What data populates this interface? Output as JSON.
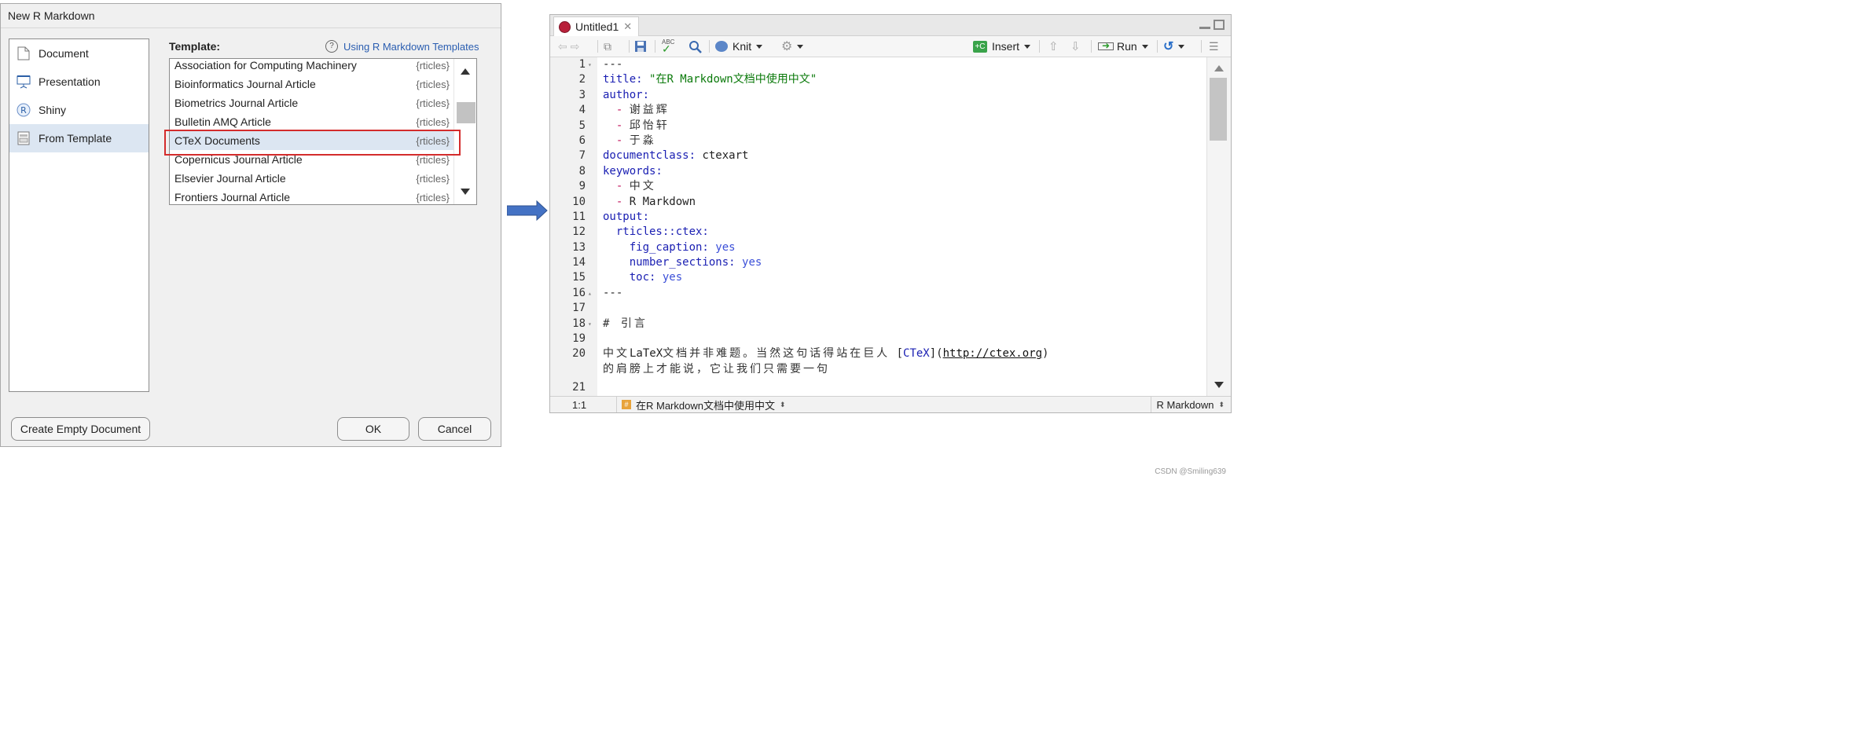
{
  "dialog": {
    "title": "New R Markdown",
    "doc_types": [
      {
        "label": "Document",
        "icon": "document-icon"
      },
      {
        "label": "Presentation",
        "icon": "presentation-icon"
      },
      {
        "label": "Shiny",
        "icon": "shiny-icon"
      },
      {
        "label": "From Template",
        "icon": "template-icon",
        "selected": true
      }
    ],
    "template_label": "Template:",
    "help_link": "Using R Markdown Templates",
    "templates": [
      {
        "name": "Association for Computing Machinery",
        "pkg": "{rticles}"
      },
      {
        "name": "Bioinformatics Journal Article",
        "pkg": "{rticles}"
      },
      {
        "name": "Biometrics Journal Article",
        "pkg": "{rticles}"
      },
      {
        "name": "Bulletin AMQ Article",
        "pkg": "{rticles}"
      },
      {
        "name": "CTeX Documents",
        "pkg": "{rticles}",
        "selected": true
      },
      {
        "name": "Copernicus Journal Article",
        "pkg": "{rticles}"
      },
      {
        "name": "Elsevier Journal Article",
        "pkg": "{rticles}"
      },
      {
        "name": "Frontiers Journal Article",
        "pkg": "{rticles}"
      }
    ],
    "buttons": {
      "empty": "Create Empty Document",
      "ok": "OK",
      "cancel": "Cancel"
    }
  },
  "editor": {
    "tab_title": "Untitled1",
    "toolbar": {
      "knit": "Knit",
      "insert": "Insert",
      "run": "Run"
    },
    "lines": [
      {
        "n": "1",
        "fold": "▾"
      },
      {
        "n": "2"
      },
      {
        "n": "3"
      },
      {
        "n": "4"
      },
      {
        "n": "5"
      },
      {
        "n": "6"
      },
      {
        "n": "7"
      },
      {
        "n": "8"
      },
      {
        "n": "9"
      },
      {
        "n": "10"
      },
      {
        "n": "11"
      },
      {
        "n": "12"
      },
      {
        "n": "13"
      },
      {
        "n": "14"
      },
      {
        "n": "15"
      },
      {
        "n": "16",
        "fold": "▴"
      },
      {
        "n": "17"
      },
      {
        "n": "18",
        "fold": "▾"
      },
      {
        "n": "19"
      },
      {
        "n": "20"
      },
      {
        "n": ""
      },
      {
        "n": "21"
      }
    ],
    "code": {
      "l1": "---",
      "l2_key": "title: ",
      "l2_val": "\"在R Markdown文档中使用中文\"",
      "l3": "author:",
      "l4": "谢益辉",
      "l5": "邱怡轩",
      "l6": "于淼",
      "l7_key": "documentclass: ",
      "l7_val": "ctexart",
      "l8": "keywords:",
      "l9": "中文",
      "l10": "R Markdown",
      "l11": "output:",
      "l12": "rticles::ctex:",
      "l13_key": "fig_caption: ",
      "l13_val": "yes",
      "l14_key": "number_sections: ",
      "l14_val": "yes",
      "l15_key": "toc: ",
      "l15_val": "yes",
      "l16": "---",
      "l18": "# 引言",
      "l20_a": "中文",
      "l20_b": "LaTeX",
      "l20_c": "文档并非难题。当然这句话得站在巨人",
      "l20_link_open": " [",
      "l20_link": "CTeX",
      "l20_link_mid": "](",
      "l20_url": "http://ctex.org",
      "l20_close": ")",
      "l20_wrap": "的肩膀上才能说，它让我们只需要一句"
    },
    "status": {
      "pos": "1:1",
      "section": "在R Markdown文档中使用中文",
      "mode": "R Markdown"
    }
  },
  "watermark": "CSDN @Smiling639",
  "colors": {
    "highlight": "#d42c2c",
    "arrow": "#4472c4",
    "selection": "#dce6f2"
  }
}
